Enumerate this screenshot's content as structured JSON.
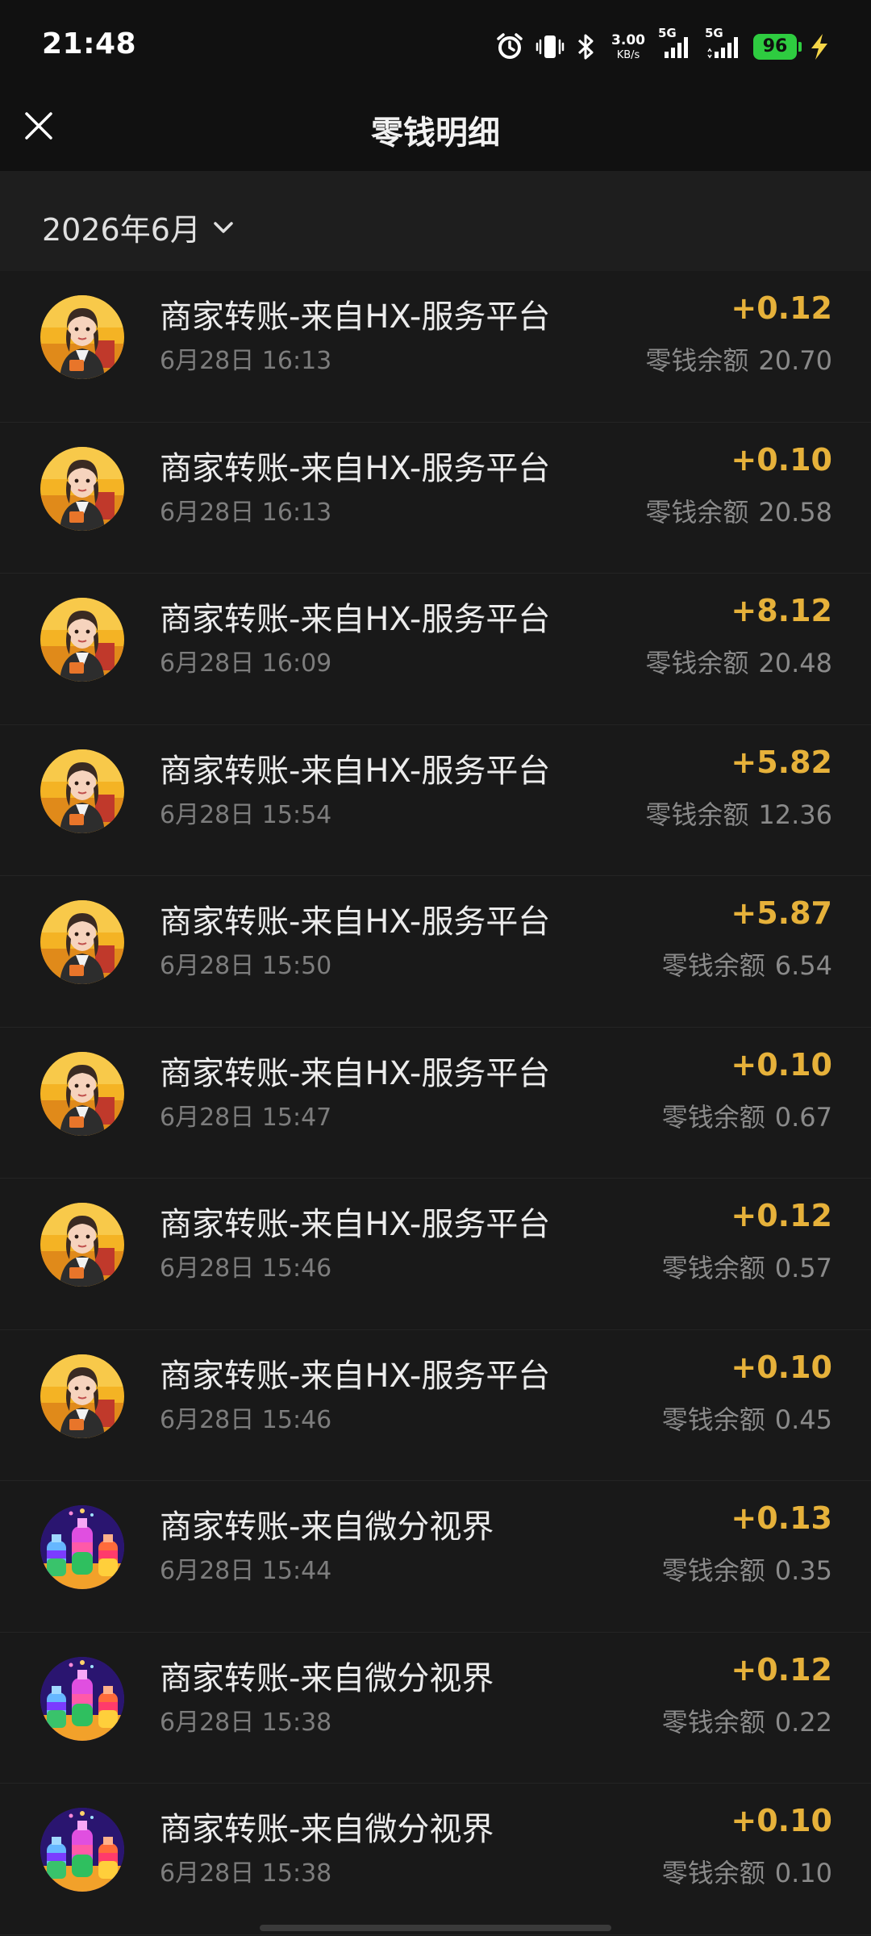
{
  "status_bar": {
    "time": "21:48",
    "net_speed_value": "3.00",
    "net_speed_unit": "KB/s",
    "sim1_label": "5G",
    "sim2_label": "5G",
    "battery": "96",
    "icons": [
      "alarm-icon",
      "vibrate-icon",
      "bluetooth-icon",
      "signal-icon",
      "signal-icon",
      "battery-icon",
      "charging-icon"
    ]
  },
  "header": {
    "title": "零钱明细",
    "close_icon": "close-icon"
  },
  "filter": {
    "month_label": "2026年6月",
    "chevron_icon": "chevron-down-icon"
  },
  "colors": {
    "amount": "#e6b13a",
    "background": "#191919",
    "header": "#111111",
    "battery": "#2ecc40"
  },
  "transactions": [
    {
      "title": "商家转账-来自HX-服务平台",
      "time": "6月28日 16:13",
      "amount": "+0.12",
      "balance_label": "零钱余额",
      "balance": "20.70",
      "avatar": "woman-avatar"
    },
    {
      "title": "商家转账-来自HX-服务平台",
      "time": "6月28日 16:13",
      "amount": "+0.10",
      "balance_label": "零钱余额",
      "balance": "20.58",
      "avatar": "woman-avatar"
    },
    {
      "title": "商家转账-来自HX-服务平台",
      "time": "6月28日 16:09",
      "amount": "+8.12",
      "balance_label": "零钱余额",
      "balance": "20.48",
      "avatar": "woman-avatar"
    },
    {
      "title": "商家转账-来自HX-服务平台",
      "time": "6月28日 15:54",
      "amount": "+5.82",
      "balance_label": "零钱余额",
      "balance": "12.36",
      "avatar": "woman-avatar"
    },
    {
      "title": "商家转账-来自HX-服务平台",
      "time": "6月28日 15:50",
      "amount": "+5.87",
      "balance_label": "零钱余额",
      "balance": "6.54",
      "avatar": "woman-avatar"
    },
    {
      "title": "商家转账-来自HX-服务平台",
      "time": "6月28日 15:47",
      "amount": "+0.10",
      "balance_label": "零钱余额",
      "balance": "0.67",
      "avatar": "woman-avatar"
    },
    {
      "title": "商家转账-来自HX-服务平台",
      "time": "6月28日 15:46",
      "amount": "+0.12",
      "balance_label": "零钱余额",
      "balance": "0.57",
      "avatar": "woman-avatar"
    },
    {
      "title": "商家转账-来自HX-服务平台",
      "time": "6月28日 15:46",
      "amount": "+0.10",
      "balance_label": "零钱余额",
      "balance": "0.45",
      "avatar": "woman-avatar"
    },
    {
      "title": "商家转账-来自微分视界",
      "time": "6月28日 15:44",
      "amount": "+0.13",
      "balance_label": "零钱余额",
      "balance": "0.35",
      "avatar": "potion-bottles-avatar"
    },
    {
      "title": "商家转账-来自微分视界",
      "time": "6月28日 15:38",
      "amount": "+0.12",
      "balance_label": "零钱余额",
      "balance": "0.22",
      "avatar": "potion-bottles-avatar"
    },
    {
      "title": "商家转账-来自微分视界",
      "time": "6月28日 15:38",
      "amount": "+0.10",
      "balance_label": "零钱余额",
      "balance": "0.10",
      "avatar": "potion-bottles-avatar"
    }
  ]
}
